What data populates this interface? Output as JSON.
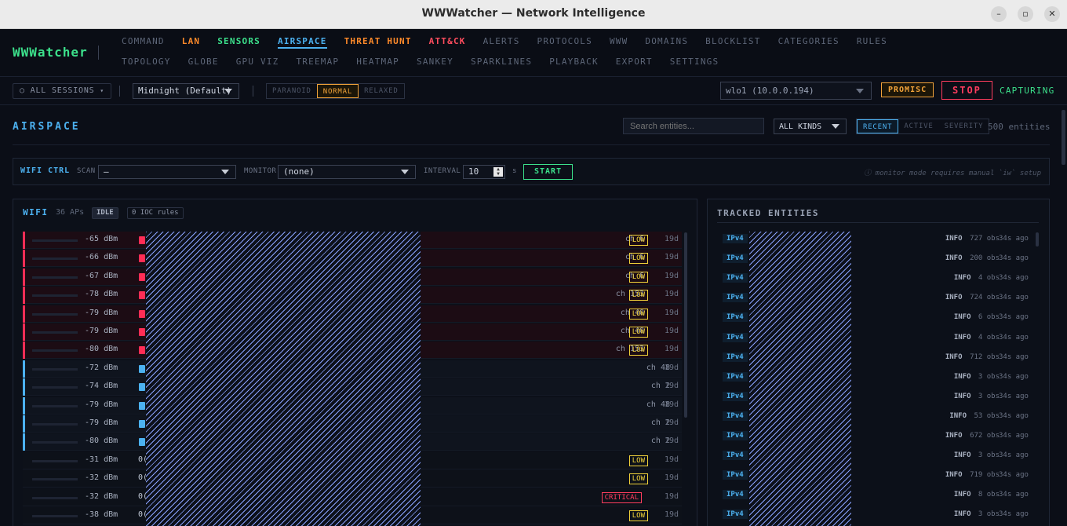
{
  "window": {
    "title": "WWWatcher — Network Intelligence"
  },
  "nav": {
    "brand": "WWWatcher",
    "row1": [
      {
        "label": "COMMAND"
      },
      {
        "label": "LAN",
        "style": "orange"
      },
      {
        "label": "SENSORS",
        "style": "green"
      },
      {
        "label": "AIRSPACE",
        "style": "active"
      },
      {
        "label": "THREAT HUNT",
        "style": "orange"
      },
      {
        "label": "ATT&CK",
        "style": "red"
      },
      {
        "label": "ALERTS"
      },
      {
        "label": "PROTOCOLS"
      },
      {
        "label": "WWW"
      },
      {
        "label": "DOMAINS"
      },
      {
        "label": "BLOCKLIST"
      },
      {
        "label": "CATEGORIES"
      },
      {
        "label": "RULES"
      }
    ],
    "row2": [
      {
        "label": "TOPOLOGY"
      },
      {
        "label": "GLOBE"
      },
      {
        "label": "GPU VIZ"
      },
      {
        "label": "TREEMAP"
      },
      {
        "label": "HEATMAP"
      },
      {
        "label": "SANKEY"
      },
      {
        "label": "SPARKLINES"
      },
      {
        "label": "PLAYBACK"
      },
      {
        "label": "EXPORT"
      },
      {
        "label": "SETTINGS"
      }
    ]
  },
  "toolbar": {
    "sessions": "ALL SESSIONS",
    "theme": "Midnight (Default)",
    "modes": [
      "PARANOID",
      "NORMAL",
      "RELAXED"
    ],
    "active_mode": "NORMAL",
    "interface": "wlo1 (10.0.0.194)",
    "promisc": "PROMISC",
    "stop": "STOP",
    "status": "CAPTURING"
  },
  "airspace": {
    "title": "AIRSPACE",
    "search_placeholder": "Search entities...",
    "kind_filter": "ALL KINDS",
    "sort_options": [
      "RECENT",
      "ACTIVE",
      "SEVERITY"
    ],
    "active_sort": "RECENT",
    "entity_count": "500 entities"
  },
  "wifi_ctrl": {
    "title": "WIFI CTRL",
    "scan_label": "SCAN",
    "scan_value": "–",
    "monitor_label": "MONITOR",
    "monitor_value": "(none)",
    "interval_label": "INTERVAL",
    "interval_value": "10",
    "interval_unit": "s",
    "start": "START",
    "note": "ⓘ monitor mode requires manual `iw` setup"
  },
  "wifi": {
    "title": "WIFI",
    "ap_count": "36 APs",
    "state": "IDLE",
    "ioc": "0 IOC rules",
    "rows": [
      {
        "dbm": "-65 dBm",
        "kind": "red",
        "ch": "ch 6",
        "sev": "LOW",
        "age": "19d"
      },
      {
        "dbm": "-66 dBm",
        "kind": "red",
        "ch": "ch 6",
        "sev": "LOW",
        "age": "19d"
      },
      {
        "dbm": "-67 dBm",
        "kind": "red",
        "ch": "ch 6",
        "sev": "LOW",
        "age": "19d"
      },
      {
        "dbm": "-78 dBm",
        "kind": "red",
        "ch": "ch 153",
        "sev": "LOW",
        "age": "19d"
      },
      {
        "dbm": "-79 dBm",
        "kind": "red",
        "ch": "ch 40",
        "sev": "LOW",
        "age": "19d"
      },
      {
        "dbm": "-79 dBm",
        "kind": "red",
        "ch": "ch 40",
        "sev": "LOW",
        "age": "19d"
      },
      {
        "dbm": "-80 dBm",
        "kind": "red",
        "ch": "ch 153",
        "sev": "LOW",
        "age": "19d"
      },
      {
        "dbm": "-72 dBm",
        "kind": "blue",
        "ch": "ch 48",
        "sev": "",
        "age": "19d"
      },
      {
        "dbm": "-74 dBm",
        "kind": "blue",
        "ch": "ch 2",
        "sev": "",
        "age": "19d"
      },
      {
        "dbm": "-79 dBm",
        "kind": "blue",
        "ch": "ch 48",
        "sev": "",
        "age": "19d"
      },
      {
        "dbm": "-79 dBm",
        "kind": "blue",
        "ch": "ch 2",
        "sev": "",
        "age": "19d"
      },
      {
        "dbm": "-80 dBm",
        "kind": "blue",
        "ch": "ch 2",
        "sev": "",
        "age": "19d"
      },
      {
        "dbm": "-31 dBm",
        "kind": "none",
        "lead": "0(",
        "ch": "",
        "sev": "LOW",
        "age": "19d"
      },
      {
        "dbm": "-32 dBm",
        "kind": "none",
        "lead": "0(",
        "ch": "",
        "sev": "LOW",
        "age": "19d"
      },
      {
        "dbm": "-32 dBm",
        "kind": "none",
        "lead": "0(",
        "ch": "",
        "sev": "CRITICAL",
        "age": "19d"
      },
      {
        "dbm": "-38 dBm",
        "kind": "none",
        "lead": "0(",
        "ch": "",
        "sev": "LOW",
        "age": "19d"
      }
    ]
  },
  "tracked": {
    "title": "TRACKED ENTITIES",
    "rows": [
      {
        "kind": "IPv4",
        "level": "INFO",
        "obs": "727 obs",
        "ago": "34s ago"
      },
      {
        "kind": "IPv4",
        "level": "INFO",
        "obs": "200 obs",
        "ago": "34s ago"
      },
      {
        "kind": "IPv4",
        "level": "INFO",
        "obs": "4 obs",
        "ago": "34s ago"
      },
      {
        "kind": "IPv4",
        "level": "INFO",
        "obs": "724 obs",
        "ago": "34s ago"
      },
      {
        "kind": "IPv4",
        "level": "INFO",
        "obs": "6 obs",
        "ago": "34s ago"
      },
      {
        "kind": "IPv4",
        "level": "INFO",
        "obs": "4 obs",
        "ago": "34s ago"
      },
      {
        "kind": "IPv4",
        "level": "INFO",
        "obs": "712 obs",
        "ago": "34s ago"
      },
      {
        "kind": "IPv4",
        "level": "INFO",
        "obs": "3 obs",
        "ago": "34s ago"
      },
      {
        "kind": "IPv4",
        "level": "INFO",
        "obs": "3 obs",
        "ago": "34s ago"
      },
      {
        "kind": "IPv4",
        "level": "INFO",
        "obs": "53 obs",
        "ago": "34s ago"
      },
      {
        "kind": "IPv4",
        "level": "INFO",
        "obs": "672 obs",
        "ago": "34s ago"
      },
      {
        "kind": "IPv4",
        "level": "INFO",
        "obs": "3 obs",
        "ago": "34s ago"
      },
      {
        "kind": "IPv4",
        "level": "INFO",
        "obs": "719 obs",
        "ago": "34s ago"
      },
      {
        "kind": "IPv4",
        "level": "INFO",
        "obs": "8 obs",
        "ago": "34s ago"
      },
      {
        "kind": "IPv4",
        "level": "INFO",
        "obs": "3 obs",
        "ago": "34s ago"
      }
    ]
  },
  "colors": {
    "accent": "#4cb1f0",
    "brand": "#3ce08b",
    "warn": "#f2a33a",
    "danger": "#ff3d5e",
    "low": "#f2d33a"
  },
  "icons": {
    "minimize": "minimize-icon",
    "maximize": "maximize-icon",
    "close": "close-icon",
    "session": "circle-icon",
    "dropdown": "chevron-down-icon",
    "info": "info-icon"
  }
}
